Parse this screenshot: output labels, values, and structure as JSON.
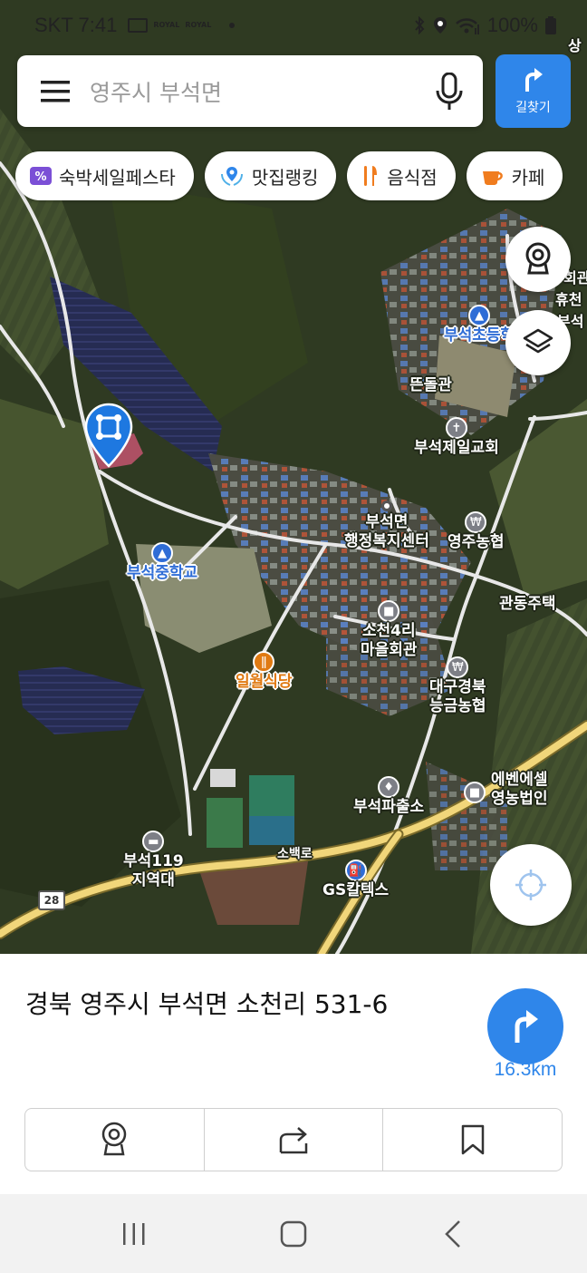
{
  "status_bar": {
    "carrier_time": "SKT 7:41",
    "app_tag_1": "ROYAL",
    "app_tag_2": "ROYAL",
    "battery": "100%",
    "icons": [
      "gallery-icon",
      "bluetooth-icon",
      "location-icon",
      "wifi-icon",
      "signal-icon",
      "battery-icon"
    ]
  },
  "search": {
    "menu_icon": "menu-icon",
    "text": "영주시 부석면",
    "mic_icon": "microphone-icon",
    "route_label": "길찾기",
    "route_icon": "turn-right-arrow-icon"
  },
  "chips": [
    {
      "label": "숙박세일페스타",
      "icon": "percent-icon",
      "color": "#7b4fd6"
    },
    {
      "label": "맛집랭킹",
      "icon": "location-laurel-icon",
      "color": "#2f86ea"
    },
    {
      "label": "음식점",
      "icon": "fork-knife-icon",
      "color": "#f07c1e"
    },
    {
      "label": "카페",
      "icon": "coffee-cup-icon",
      "color": "#f07c1e"
    }
  ],
  "map": {
    "labels": {
      "church_top": "부석초등학",
      "edge_1": "상",
      "edge_2": "회관",
      "edge_3": "휴천",
      "edge_4": "부석",
      "ddeundolgwan": "뜬돌관",
      "church": "부석제일교회",
      "office_line1": "부석면",
      "office_line2": "행정복지센터",
      "nonghyup": "영주농협",
      "school": "부석중학교",
      "gwandong": "관동주택",
      "hall_line1": "소천4리",
      "hall_line2": "마을회관",
      "restaurant": "일월식당",
      "bank_line1": "대구경북",
      "bank_line2": "능금농협",
      "police": "부석파출소",
      "corp_line1": "에벤에셀",
      "corp_line2": "영농법인",
      "fire_line1": "부석119",
      "fire_line2": "지역대",
      "road": "소백로",
      "gas": "GS칼텍스",
      "route_no": "28"
    }
  },
  "sheet": {
    "address": "경북 영주시 부석면 소천리 531-6",
    "distance": "16.3km",
    "actions": [
      "street-view-icon",
      "share-icon",
      "bookmark-icon"
    ]
  },
  "colors": {
    "accent": "#2f86ea",
    "pin": "#1e78e0",
    "highlight": "#d8587a"
  }
}
